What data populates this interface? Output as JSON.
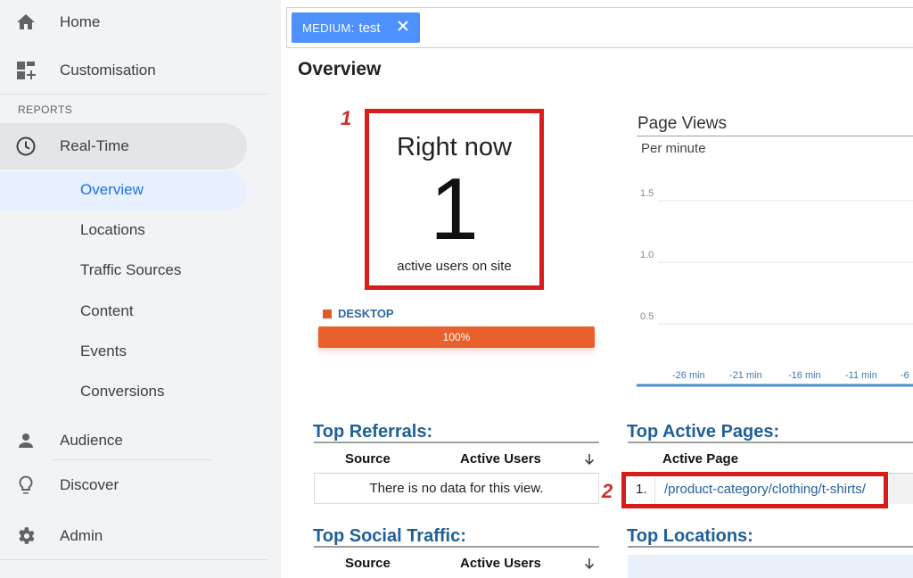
{
  "sidebar": {
    "home_label": "Home",
    "customisation_label": "Customisation",
    "reports_section": "REPORTS",
    "realtime_label": "Real-Time",
    "realtime_items": [
      {
        "label": "Overview",
        "active": true
      },
      {
        "label": "Locations"
      },
      {
        "label": "Traffic Sources"
      },
      {
        "label": "Content"
      },
      {
        "label": "Events"
      },
      {
        "label": "Conversions"
      }
    ],
    "audience_label": "Audience",
    "discover_label": "Discover",
    "admin_label": "Admin"
  },
  "filter": {
    "key": "MEDIUM",
    "sep": ":",
    "value": "test"
  },
  "page_title": "Overview",
  "callouts": {
    "one": "1",
    "two": "2"
  },
  "right_now": {
    "title": "Right now",
    "count": "1",
    "subtitle": "active users on site"
  },
  "devices": {
    "legend": "DESKTOP",
    "percent_label": "100%",
    "share": 1.0
  },
  "page_views": {
    "title": "Page Views",
    "subtitle": "Per minute"
  },
  "chart_data": {
    "type": "bar",
    "title": "Page Views",
    "subtitle": "Per minute",
    "y_ticks": [
      "1.5",
      "1.0",
      "0.5"
    ],
    "x_ticks": [
      "-26 min",
      "-21 min",
      "-16 min",
      "-11 min",
      "-6"
    ],
    "ylim": [
      0,
      2
    ],
    "grid": true,
    "series": []
  },
  "top_referrals": {
    "title": "Top Referrals:",
    "col_source": "Source",
    "col_users": "Active Users",
    "empty_message": "There is no data for this view."
  },
  "top_active_pages": {
    "title": "Top Active Pages:",
    "col_page": "Active Page",
    "rows": [
      {
        "rank": "1.",
        "page": "/product-category/clothing/t-shirts/"
      }
    ]
  },
  "top_social": {
    "title": "Top Social Traffic:",
    "col_source": "Source",
    "col_users": "Active Users"
  },
  "top_locations": {
    "title": "Top Locations:"
  },
  "colors": {
    "accent": "#1a73e8",
    "highlight": "#d81b1b",
    "desktop": "#e8612c",
    "heading": "#1f5f99",
    "chip": "#4d90fe"
  }
}
